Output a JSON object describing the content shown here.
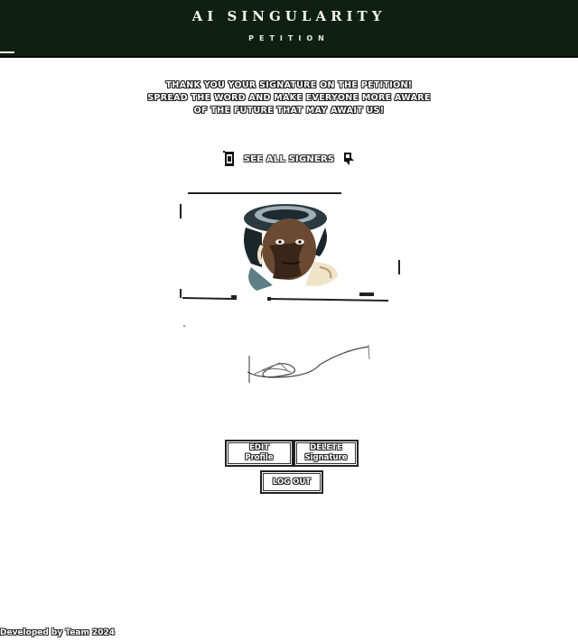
{
  "header": {
    "title": "AI SINGULARITY",
    "subtitle": "PETITION",
    "background": "#0f1f11"
  },
  "message": {
    "line1": "THANK YOU YOUR SIGNATURE ON THE PETITION!",
    "line2": "SPREAD THE WORD AND MAKE EVERYONE MORE AWARE",
    "line3": "OF THE FUTURE THAT MAY AWAIT US!"
  },
  "signers_link": {
    "label": "SEE ALL SIGNERS",
    "left_icon": "flourish-left-icon",
    "right_icon": "flourish-right-icon"
  },
  "portrait": {
    "icon": "user-portrait-image"
  },
  "signature": {
    "icon": "signature-image"
  },
  "buttons": {
    "edit_line1": "EDIT",
    "edit_line2": "Profile",
    "delete_line1": "DELETE",
    "delete_line2": "Signature",
    "logout": "LOG OUT"
  },
  "footer": {
    "text": "Developed by Team 2024"
  }
}
